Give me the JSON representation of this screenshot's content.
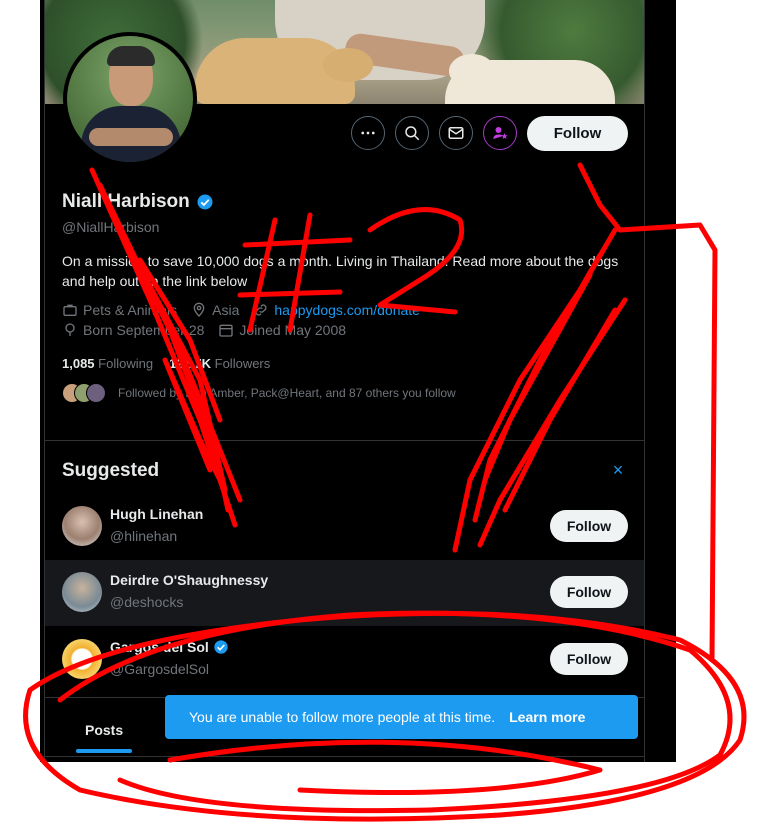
{
  "profile": {
    "name": "Niall Harbison",
    "handle": "@NiallHarbison",
    "bio": "On a mission to save 10,000 dogs a month. Living in Thailand. Read more about the dogs and help out on the link below",
    "category": "Pets & Animals",
    "location": "Asia",
    "website": "happydogs.com/donate",
    "born": "Born September 28",
    "joined": "Joined May 2008",
    "following_count": "1,085",
    "following_label": "Following",
    "followers_count": "121.7K",
    "followers_label": "Followers",
    "followed_by": "Followed by Bob Amber, Pack@Heart, and 87 others you follow",
    "follow_label": "Follow"
  },
  "suggested": {
    "title": "Suggested",
    "close": "×",
    "users": [
      {
        "name": "Hugh Linehan",
        "handle": "@hlinehan",
        "follow": "Follow"
      },
      {
        "name": "Deirdre O'Shaughnessy",
        "handle": "@deshocks",
        "follow": "Follow"
      },
      {
        "name": "Gargos del Sol",
        "handle": "@GargosdelSol",
        "follow": "Follow"
      }
    ]
  },
  "tabs": {
    "posts": "Posts"
  },
  "toast": {
    "message": "You are unable to follow more people at this time.",
    "action": "Learn more"
  },
  "annotation": {
    "text": "#2"
  },
  "colors": {
    "accent": "#1d9bf0",
    "background": "#000000",
    "scribble": "#ff0000"
  }
}
